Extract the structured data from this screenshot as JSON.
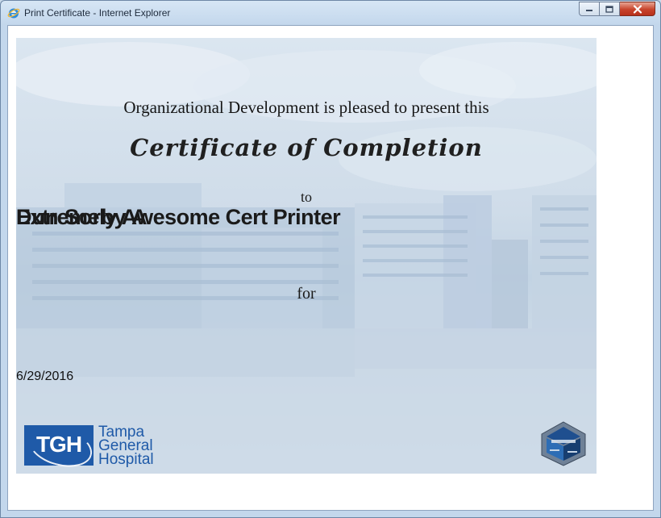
{
  "window": {
    "title": "Print Certificate - Internet Explorer",
    "icon": "internet-explorer-icon"
  },
  "certificate": {
    "intro": "Organizational Development is pleased to present this",
    "heading": "Certificate of Completion",
    "to": "to",
    "recipient_overlap_text": "Extremely Awesome Cert Printer",
    "recipient_name": "Dun Sorby A",
    "for": "for",
    "date": "6/29/2016"
  },
  "logo": {
    "letters": "TGH",
    "lines": [
      "Tampa",
      "General",
      "Hospital"
    ]
  },
  "colors": {
    "brand_blue": "#1f5aa8",
    "close_button": "#c7432b"
  }
}
